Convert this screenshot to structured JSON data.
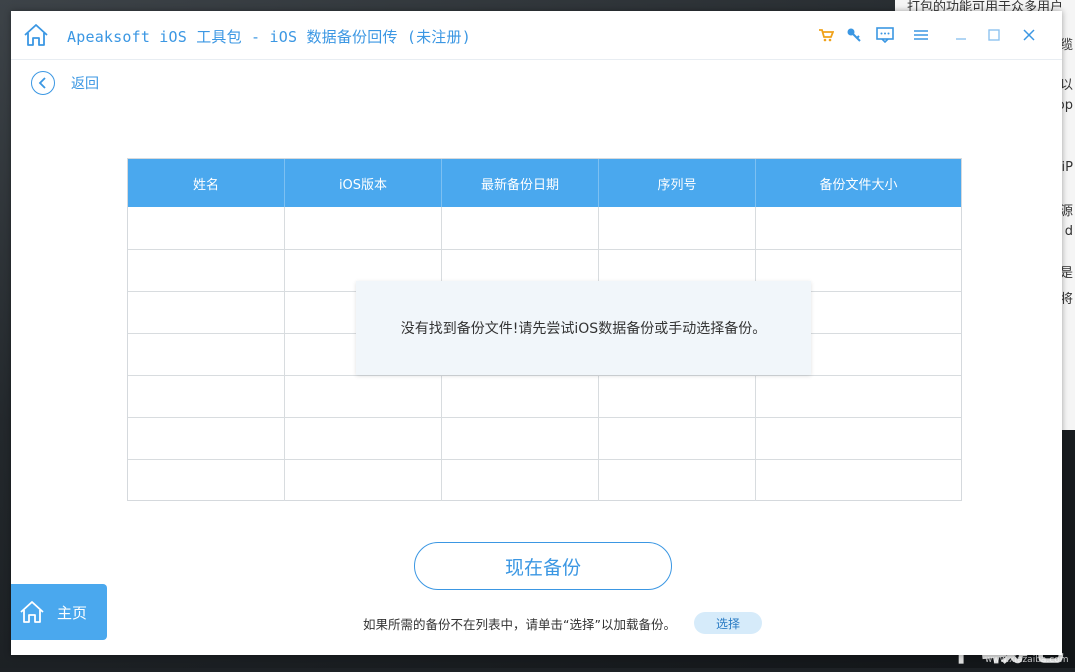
{
  "window": {
    "title": "Apeaksoft iOS 工具包 - iOS 数据备份回传 (未注册)",
    "accent_color": "#3b97e3",
    "header_color": "#4aa8ee"
  },
  "toolbar": {
    "icons": [
      "cart-icon",
      "key-icon",
      "feedback-icon",
      "menu-icon",
      "minimize-icon",
      "maximize-icon",
      "close-icon"
    ]
  },
  "nav": {
    "back_label": "返回",
    "home_label": "主页"
  },
  "table": {
    "columns": [
      "姓名",
      "iOS版本",
      "最新备份日期",
      "序列号",
      "备份文件大小"
    ],
    "empty_message": "没有找到备份文件!请先尝试iOS数据备份或手动选择备份。"
  },
  "actions": {
    "backup_now_label": "现在备份",
    "hint_text": "如果所需的备份不在列表中，请单击“选择”以加载备份。",
    "select_label": "选择"
  },
  "background": {
    "doc_lines": [
      "打包的功能可用于众多用户"
    ],
    "side_chars": [
      "缆",
      "以",
      "op",
      "iP",
      "源",
      "d",
      "是",
      "将"
    ],
    "watermark": "下载吧",
    "watermark_sub": "www.xiazaiba.com"
  }
}
